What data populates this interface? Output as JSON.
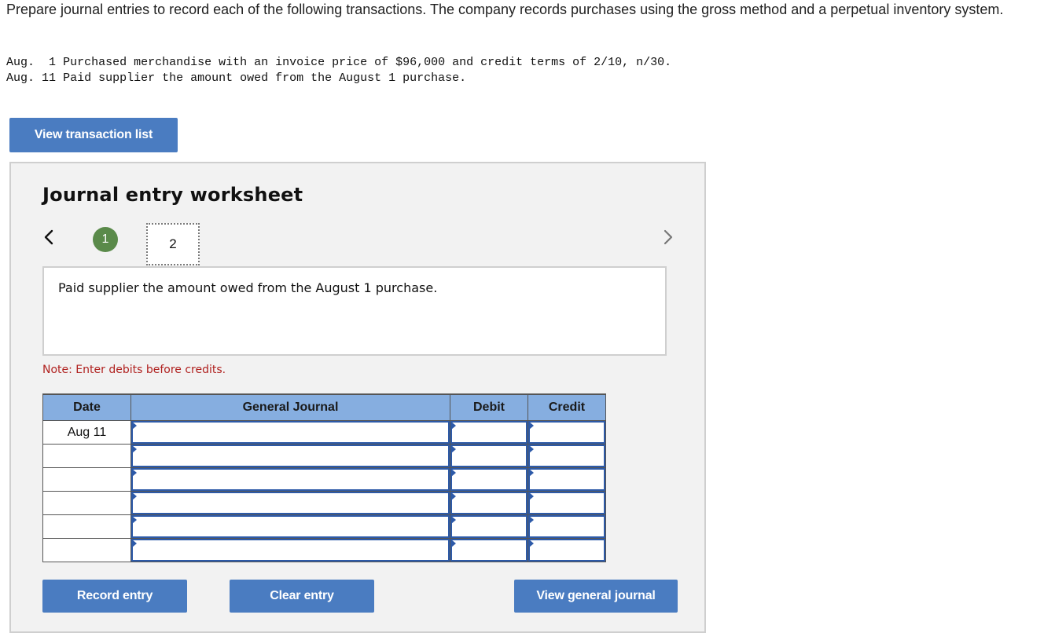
{
  "problem": {
    "instructions": "Prepare journal entries to record each of the following transactions. The company records purchases using the gross method and a perpetual inventory system.",
    "transactions": [
      {
        "month": "Aug.",
        "day": " 1",
        "text": "Purchased merchandise with an invoice price of $96,000 and credit terms of 2/10, n/30."
      },
      {
        "month": "Aug.",
        "day": "11",
        "text": "Paid supplier the amount owed from the August 1 purchase."
      }
    ]
  },
  "buttons": {
    "view_transaction_list": "View transaction list",
    "record_entry": "Record entry",
    "clear_entry": "Clear entry",
    "view_general_journal": "View general journal"
  },
  "worksheet": {
    "title": "Journal entry worksheet",
    "steps": [
      {
        "label": "1",
        "status": "completed"
      },
      {
        "label": "2",
        "status": "current"
      }
    ],
    "description": "Paid supplier the amount owed from the August 1 purchase.",
    "note": "Note: Enter debits before credits.",
    "table": {
      "headers": {
        "date": "Date",
        "general_journal": "General Journal",
        "debit": "Debit",
        "credit": "Credit"
      },
      "rows": [
        {
          "date": "Aug 11",
          "account": "",
          "debit": "",
          "credit": ""
        },
        {
          "date": "",
          "account": "",
          "debit": "",
          "credit": ""
        },
        {
          "date": "",
          "account": "",
          "debit": "",
          "credit": ""
        },
        {
          "date": "",
          "account": "",
          "debit": "",
          "credit": ""
        },
        {
          "date": "",
          "account": "",
          "debit": "",
          "credit": ""
        },
        {
          "date": "",
          "account": "",
          "debit": "",
          "credit": ""
        }
      ]
    }
  },
  "colors": {
    "button_blue": "#4a7cc1",
    "header_blue": "#86aee0",
    "step_complete_green": "#5a8a4a",
    "note_red": "#b0211f"
  },
  "icons": {
    "prev": "chevron-left-icon",
    "next": "chevron-right-icon"
  }
}
